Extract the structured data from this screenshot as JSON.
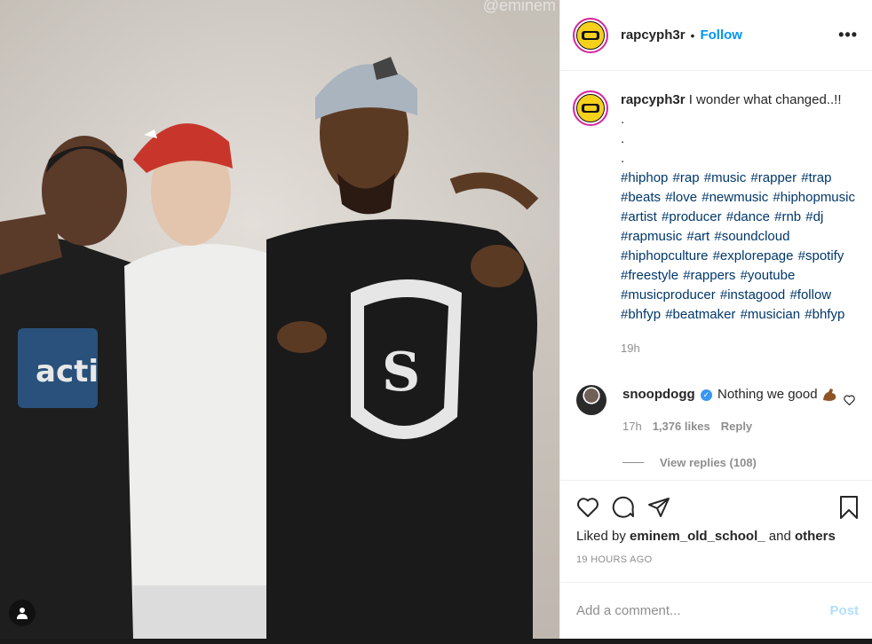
{
  "photo": {
    "watermark": "@eminem"
  },
  "header": {
    "username": "rapcyph3r",
    "separator": "•",
    "follow_label": "Follow",
    "more_label": "•••"
  },
  "caption": {
    "username": "rapcyph3r",
    "text": "I wonder what changed..!!",
    "dots": ".\n.\n.",
    "hashtags": "#hiphop #rap #music #rapper #trap #beats #love #newmusic #hiphopmusic #artist #producer #dance #rnb #dj #rapmusic #art #soundcloud #hiphopculture #explorepage #spotify #freestyle #rappers #youtube #musicproducer #instagood #follow #bhfyp #beatmaker #musician #bhfyp",
    "time": "19h"
  },
  "comment": {
    "username": "snoopdogg",
    "verified_mark": "✓",
    "text": "Nothing we good",
    "time": "17h",
    "likes": "1,376 likes",
    "reply_label": "Reply",
    "view_replies": "View replies (108)"
  },
  "actions": {
    "liked_prefix": "Liked by",
    "liked_user": "eminem_old_school_",
    "liked_and": "and",
    "liked_others": "others",
    "post_time": "19 HOURS AGO"
  },
  "comment_box": {
    "placeholder": "Add a comment...",
    "post_label": "Post"
  },
  "colors": {
    "link_blue": "#0095f6",
    "hashtag_blue": "#00376b",
    "muted": "#8e8e8e",
    "post_disabled": "#b2dffc"
  },
  "icons": [
    "user-tag-icon",
    "more-icon",
    "heart-icon",
    "comment-icon",
    "share-icon",
    "bookmark-icon",
    "verified-icon",
    "flexed-biceps-icon"
  ]
}
